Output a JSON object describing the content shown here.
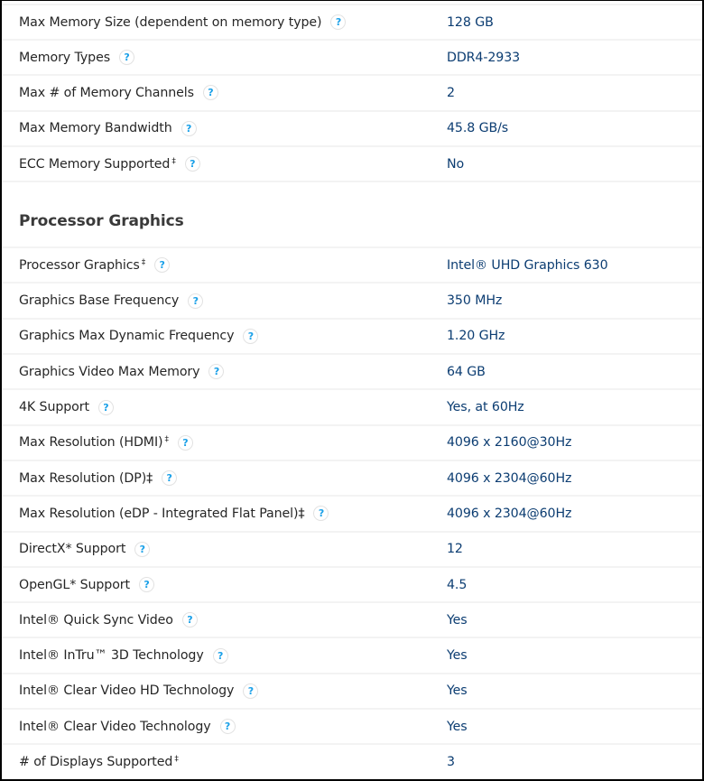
{
  "memory_rows": [
    {
      "label": "Max Memory Size (dependent on memory type)",
      "dagger": "",
      "help": true,
      "value": "128 GB"
    },
    {
      "label": "Memory Types",
      "dagger": "",
      "help": true,
      "value": "DDR4-2933"
    },
    {
      "label": "Max # of Memory Channels",
      "dagger": "",
      "help": true,
      "value": "2"
    },
    {
      "label": "Max Memory Bandwidth",
      "dagger": "",
      "help": true,
      "value": "45.8 GB/s"
    },
    {
      "label": "ECC Memory Supported",
      "dagger": "‡",
      "help": true,
      "value": "No"
    }
  ],
  "graphics_section": {
    "title": "Processor Graphics",
    "rows": [
      {
        "label": "Processor Graphics",
        "dagger": "‡",
        "help": true,
        "value": "Intel® UHD Graphics 630"
      },
      {
        "label": "Graphics Base Frequency",
        "dagger": "",
        "help": true,
        "value": "350 MHz"
      },
      {
        "label": "Graphics Max Dynamic Frequency",
        "dagger": "",
        "help": true,
        "value": "1.20 GHz"
      },
      {
        "label": "Graphics Video Max Memory",
        "dagger": "",
        "help": true,
        "value": "64 GB"
      },
      {
        "label": "4K Support",
        "dagger": "",
        "help": true,
        "value": "Yes, at 60Hz"
      },
      {
        "label": "Max Resolution (HDMI)",
        "dagger": "‡",
        "help": true,
        "value": "4096 x 2160@30Hz"
      },
      {
        "label": "Max Resolution (DP)‡",
        "dagger": "",
        "help": true,
        "value": "4096 x 2304@60Hz"
      },
      {
        "label": "Max Resolution (eDP - Integrated Flat Panel)‡",
        "dagger": "",
        "help": true,
        "value": "4096 x 2304@60Hz"
      },
      {
        "label": "DirectX* Support",
        "dagger": "",
        "help": true,
        "value": "12"
      },
      {
        "label": "OpenGL* Support",
        "dagger": "",
        "help": true,
        "value": "4.5"
      },
      {
        "label": "Intel® Quick Sync Video",
        "dagger": "",
        "help": true,
        "value": "Yes"
      },
      {
        "label": "Intel® InTru™ 3D Technology",
        "dagger": "",
        "help": true,
        "value": "Yes"
      },
      {
        "label": "Intel® Clear Video HD Technology",
        "dagger": "",
        "help": true,
        "value": "Yes"
      },
      {
        "label": "Intel® Clear Video Technology",
        "dagger": "",
        "help": true,
        "value": "Yes"
      },
      {
        "label": "# of Displays Supported",
        "dagger": "‡",
        "help": false,
        "value": "3"
      }
    ]
  },
  "icons": {
    "help": "?"
  },
  "colors": {
    "label_text": "#262626",
    "value_text": "#0c3d72",
    "help_icon": "#1aa0e8",
    "separator": "#f3f3f3",
    "heading": "#3a3a3a"
  }
}
